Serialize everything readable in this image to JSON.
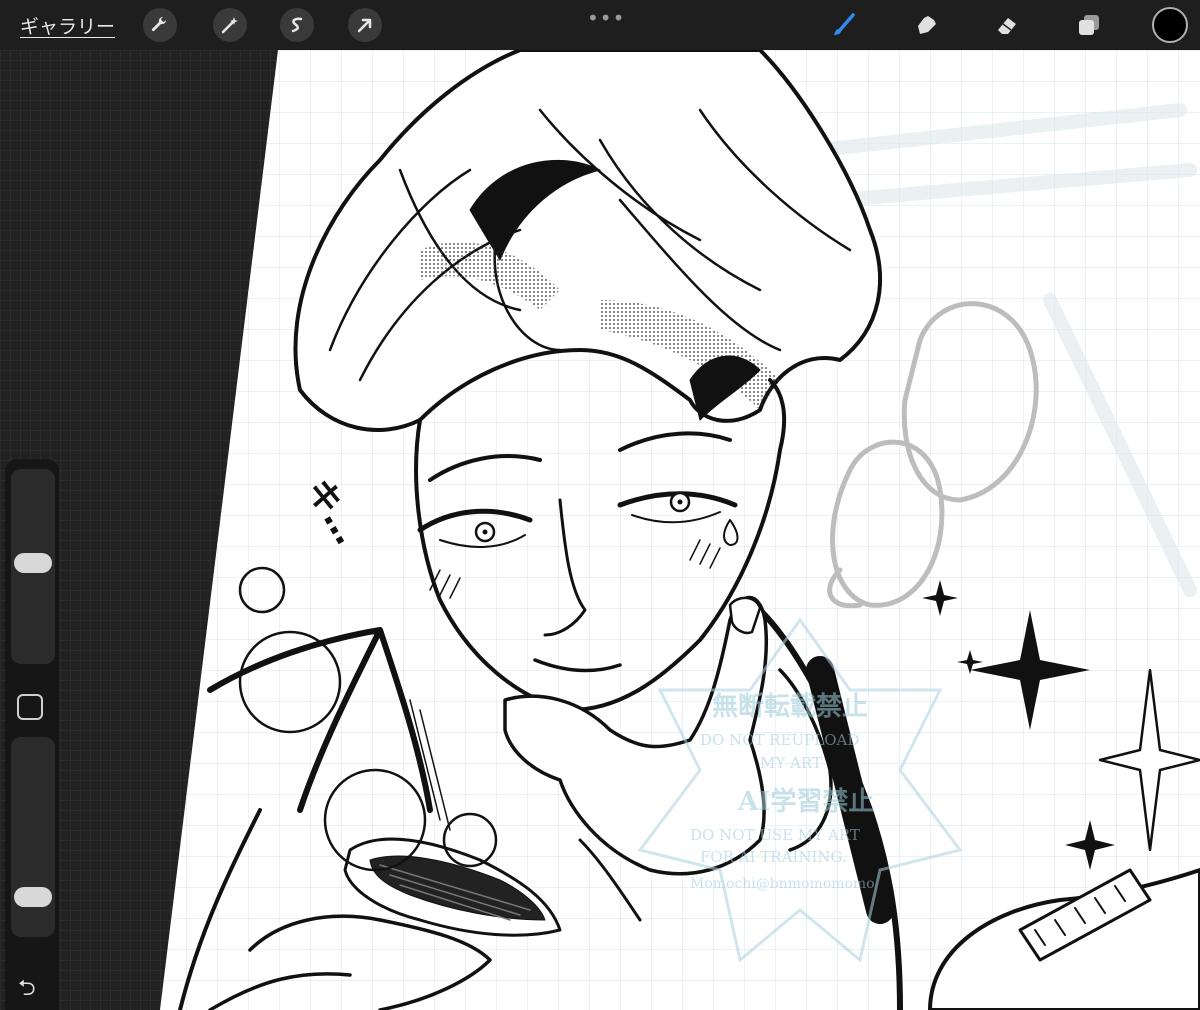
{
  "toolbar": {
    "gallery_label": "ギャラリー",
    "left_tools": [
      "wrench-icon",
      "magic-wand-icon",
      "selection-icon",
      "arrow-icon"
    ],
    "more_dots": "•••",
    "right_tools": [
      "brush-icon",
      "smudge-icon",
      "eraser-icon",
      "layers-icon"
    ],
    "current_color": "#000000",
    "accent_color": "#2f8cf0"
  },
  "sidebar": {
    "brush_size_level": 0.52,
    "opacity_level": 0.15,
    "undo_icon": "undo-icon",
    "modify_icon": "modify-square-icon"
  },
  "artwork": {
    "sfx_text": "キ…",
    "watermark_line1": "無断転載禁止",
    "watermark_line2": "DO NOT REUPLOAD",
    "watermark_line3": "MY ART",
    "watermark_line4": "AI学習禁止",
    "watermark_line5": "DO NOT USE MY ART",
    "watermark_line6": "FOR AI TRAINING.",
    "watermark_line7": "Momochi@bnmomomomo"
  }
}
